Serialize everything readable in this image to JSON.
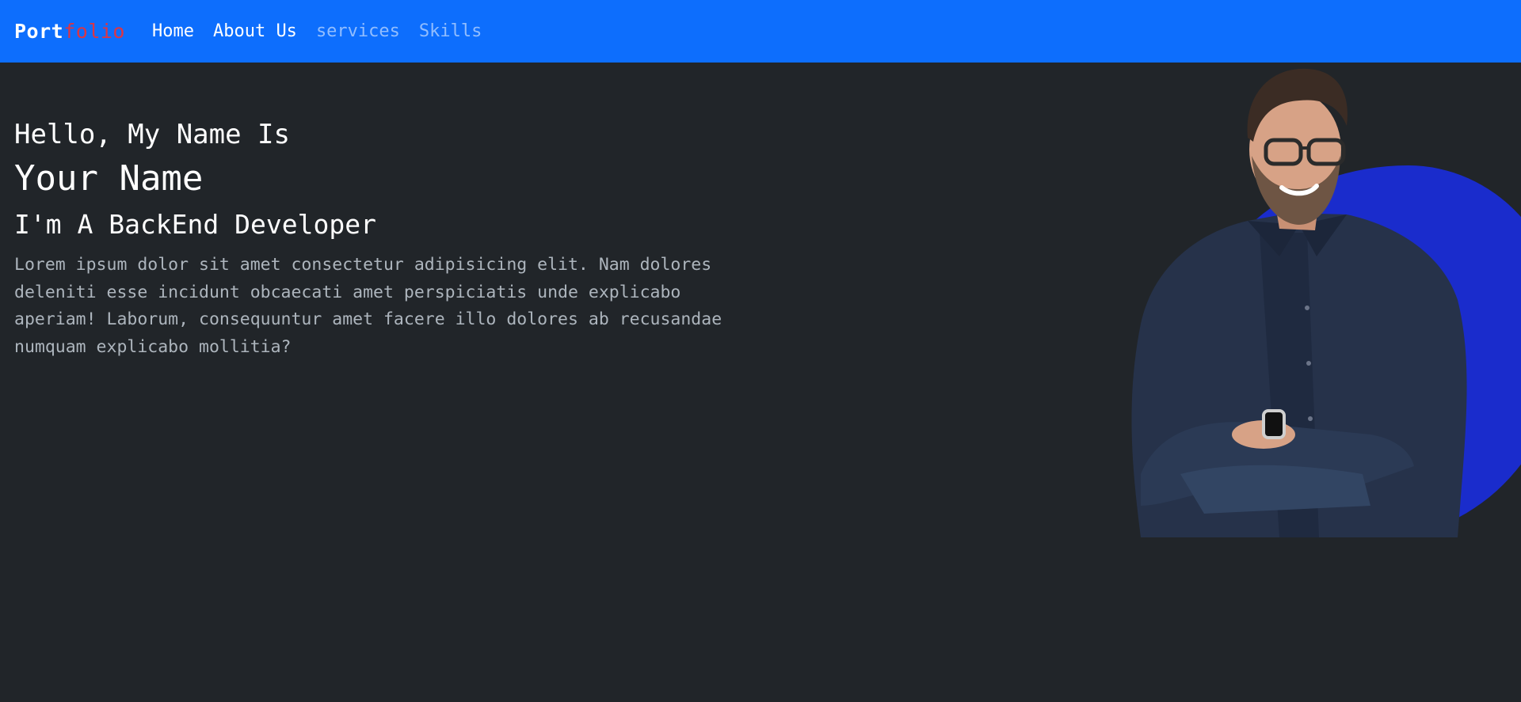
{
  "navbar": {
    "brand_main": "Port",
    "brand_accent": "folio",
    "links": [
      {
        "label": "Home",
        "state": "active"
      },
      {
        "label": "About Us",
        "state": "active"
      },
      {
        "label": "services",
        "state": "muted"
      },
      {
        "label": "Skills",
        "state": "muted"
      }
    ]
  },
  "hero": {
    "greeting": "Hello, My Name Is",
    "name": "Your Name",
    "role": "I'm A BackEnd Developer",
    "description": "Lorem ipsum dolor sit amet consectetur adipisicing elit. Nam dolores deleniti esse incidunt obcaecati amet perspiciatis unde explicabo aperiam! Laborum, consequuntur amet facere illo dolores ab recusandae numquam explicabo mollitia?"
  },
  "colors": {
    "navbar": "#0d6efd",
    "background": "#212529",
    "brand_accent": "#dc3545",
    "blob": "#1a2ccc"
  },
  "icons": {
    "hero_image": "portrait-photo"
  }
}
